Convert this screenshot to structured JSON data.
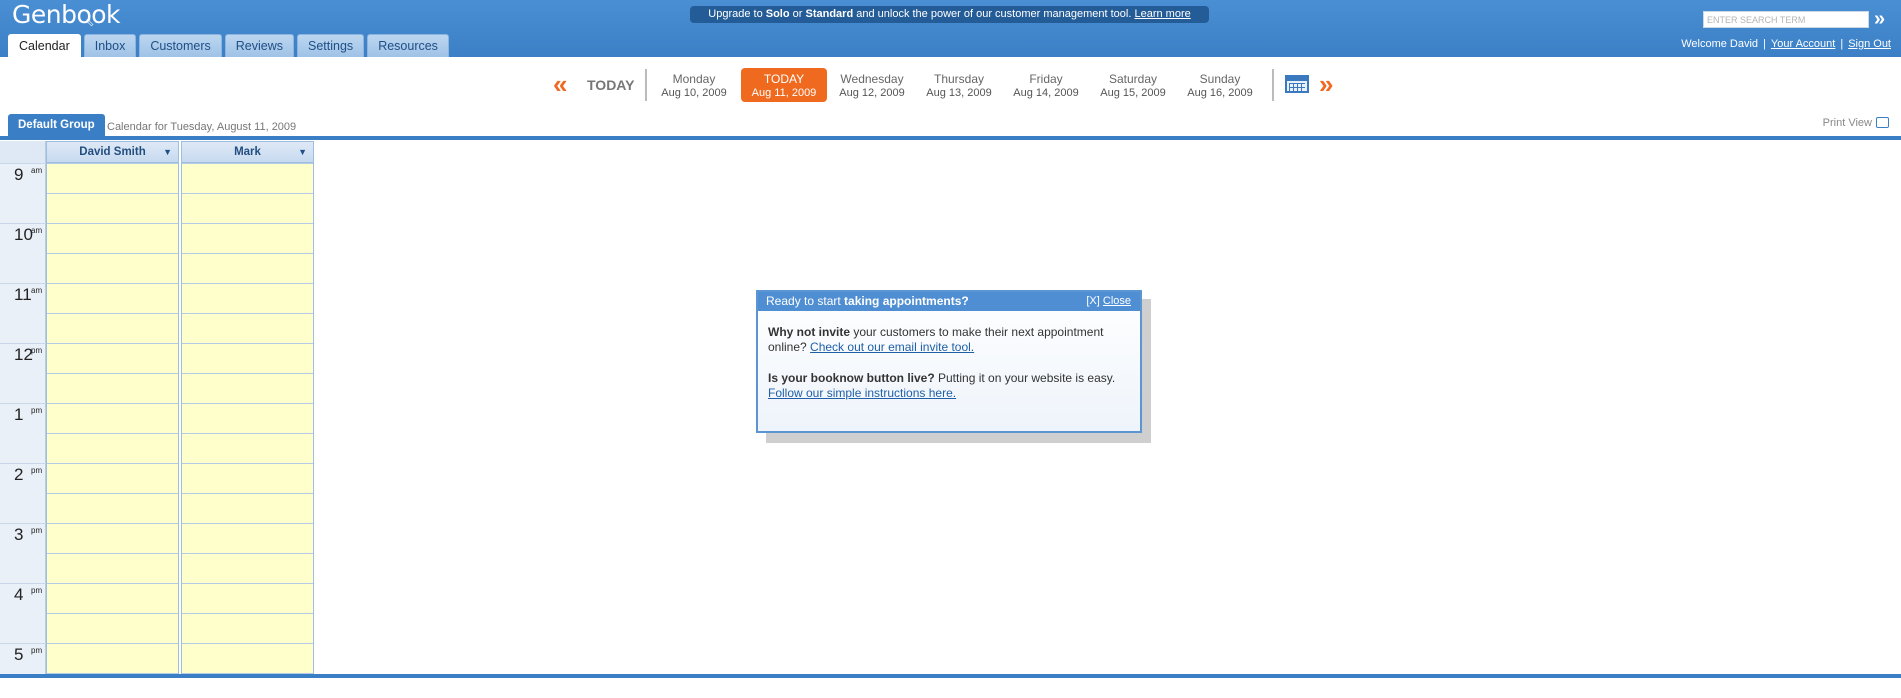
{
  "header": {
    "logo": "Genbook",
    "promo": {
      "prefix": "Upgrade to ",
      "plan1": "Solo",
      "middle": " or ",
      "plan2": "Standard",
      "suffix": " and unlock the power of our customer management tool. ",
      "link": "Learn more"
    },
    "search_placeholder": "ENTER SEARCH TERM",
    "tabs": [
      {
        "label": "Calendar",
        "active": true
      },
      {
        "label": "Inbox"
      },
      {
        "label": "Customers"
      },
      {
        "label": "Reviews"
      },
      {
        "label": "Settings"
      },
      {
        "label": "Resources"
      }
    ],
    "user": {
      "welcome": "Welcome David",
      "account": "Your Account",
      "signout": "Sign Out",
      "sep": "|"
    }
  },
  "datenav": {
    "today_label": "TODAY",
    "days": [
      {
        "name": "Monday",
        "date": "Aug 10, 2009"
      },
      {
        "name": "TODAY",
        "date": "Aug 11, 2009",
        "today": true
      },
      {
        "name": "Wednesday",
        "date": "Aug 12, 2009"
      },
      {
        "name": "Thursday",
        "date": "Aug 13, 2009"
      },
      {
        "name": "Friday",
        "date": "Aug 14, 2009"
      },
      {
        "name": "Saturday",
        "date": "Aug 15, 2009"
      },
      {
        "name": "Sunday",
        "date": "Aug 16, 2009"
      }
    ]
  },
  "group": {
    "tab": "Default Group",
    "caption": "Calendar for Tuesday, August 11, 2009",
    "print": "Print View"
  },
  "calendar": {
    "columns": [
      "David Smith",
      "Mark"
    ],
    "hours": [
      {
        "h": "9",
        "ap": "am"
      },
      {
        "h": "10",
        "ap": "am"
      },
      {
        "h": "11",
        "ap": "am"
      },
      {
        "h": "12",
        "ap": "pm"
      },
      {
        "h": "1",
        "ap": "pm"
      },
      {
        "h": "2",
        "ap": "pm"
      },
      {
        "h": "3",
        "ap": "pm"
      },
      {
        "h": "4",
        "ap": "pm"
      },
      {
        "h": "5",
        "ap": "pm"
      }
    ]
  },
  "popup": {
    "title_prefix": "Ready to start ",
    "title_bold": "taking appointments?",
    "close_bracket": "[X]",
    "close_link": "Close",
    "p1_bold": "Why not invite",
    "p1_text": " your customers to make their next appointment online? ",
    "p1_link": "Check out our email invite tool.",
    "p2_bold": "Is your booknow button live?",
    "p2_text": " Putting it on your website is easy.",
    "p2_link": "Follow our simple instructions here."
  },
  "colors": {
    "brand_blue": "#3a7fc6",
    "today_orange": "#ef6a1f",
    "slot_yellow": "#ffffcc"
  }
}
